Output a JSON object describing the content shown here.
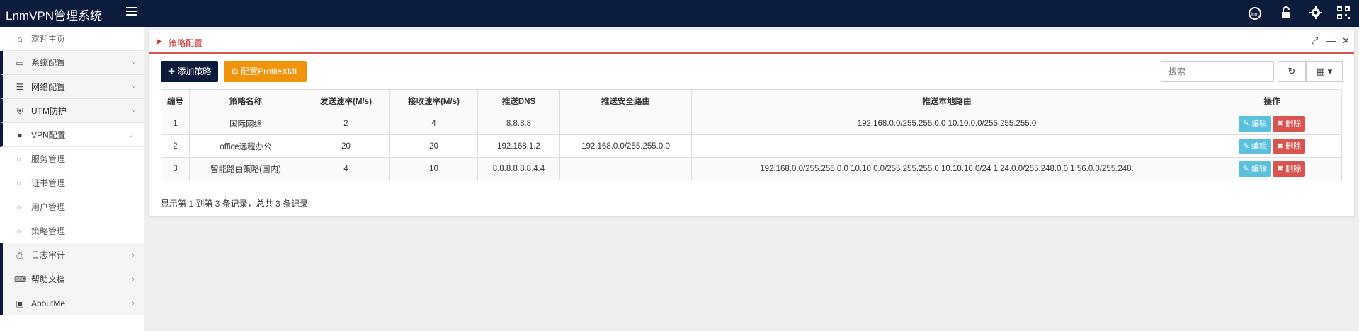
{
  "app": {
    "brand": "LnmVPN管理系统"
  },
  "topbar": {
    "icons": [
      "menu-icon",
      "logo-icon",
      "lock-icon",
      "gear-icon",
      "qrcode-icon"
    ]
  },
  "sidebar": {
    "home": {
      "label": "欢迎主页",
      "icon": "home-icon"
    },
    "items": [
      {
        "label": "系统配置",
        "icon": "monitor-icon"
      },
      {
        "label": "网络配置",
        "icon": "server-icon"
      },
      {
        "label": "UTM防护",
        "icon": "shield-icon"
      },
      {
        "label": "VPN配置",
        "icon": "globe-icon"
      }
    ],
    "vpn_sub": [
      {
        "label": "服务管理"
      },
      {
        "label": "证书管理"
      },
      {
        "label": "用户管理"
      },
      {
        "label": "策略管理"
      }
    ],
    "bottom": [
      {
        "label": "日志审计",
        "icon": "print-icon"
      },
      {
        "label": "帮助文档",
        "icon": "keyboard-icon"
      },
      {
        "label": "AboutMe",
        "icon": "contact-icon"
      }
    ]
  },
  "panel": {
    "title": "策略配置",
    "add_btn": "添加策略",
    "profile_btn": "配置ProfileXML",
    "search_placeholder": "搜索"
  },
  "table": {
    "headers": [
      "编号",
      "策略名称",
      "发送速率(M/s)",
      "接收速率(M/s)",
      "推送DNS",
      "推送安全路由",
      "推送本地路由",
      "操作"
    ],
    "rows": [
      [
        "1",
        "国际网络",
        "2",
        "4",
        "8.8.8.8",
        "",
        "192.168.0.0/255.255.0.0 10.10.0.0/255.255.255.0"
      ],
      [
        "2",
        "office远程办公",
        "20",
        "20",
        "192.168.1.2",
        "192.168.0.0/255.255.0.0",
        ""
      ],
      [
        "3",
        "智能路由策略(国内)",
        "4",
        "10",
        "8.8.8.8 8.8.4.4",
        "",
        "192.168.0.0/255.255.0.0 10.10.0.0/255.255.255.0 10.10.10.0/24 1.24.0.0/255.248.0.0 1.56.0.0/255.248."
      ]
    ],
    "edit_label": "编辑",
    "delete_label": "删除"
  },
  "pagination": {
    "summary": "显示第 1 到第 3 条记录，总共 3 条记录"
  }
}
